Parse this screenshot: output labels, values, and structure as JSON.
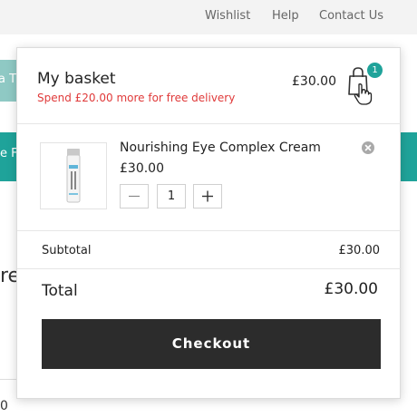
{
  "topnav": {
    "wishlist": "Wishlist",
    "help": "Help",
    "contact": "Contact Us"
  },
  "background": {
    "tab_one_text": "a T",
    "tab_two_text": "e F",
    "fragment_text": "re",
    "fragment_number": "0"
  },
  "basket": {
    "title": "My basket",
    "delivery_note": "Spend £20.00 more for free delivery",
    "header_total": "£30.00",
    "item_count": "1",
    "items": [
      {
        "name": "Nourishing Eye Complex Cream",
        "price": "£30.00",
        "quantity": "1"
      }
    ],
    "subtotal_label": "Subtotal",
    "subtotal_value": "£30.00",
    "total_label": "Total",
    "total_value": "£30.00",
    "checkout_label": "Checkout"
  },
  "colors": {
    "accent": "#1fa39a",
    "warning": "#e03a3a",
    "checkout_bg": "#2c2c2c"
  },
  "icons": {
    "bag": "shopping-bag-icon",
    "cursor": "hand-cursor-icon",
    "remove": "remove-circle-icon",
    "minus": "minus-icon",
    "plus": "plus-icon"
  }
}
